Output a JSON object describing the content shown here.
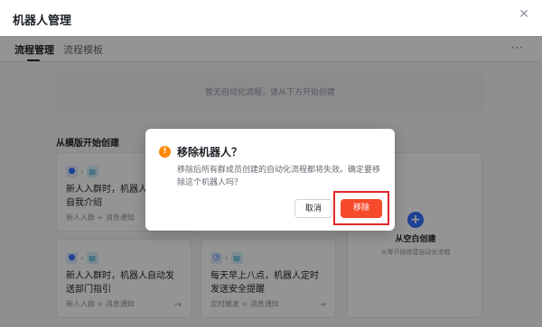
{
  "window": {
    "title": "机器人管理",
    "close_icon": "close-icon"
  },
  "tabs": [
    {
      "label": "流程管理",
      "active": true
    },
    {
      "label": "流程模板",
      "active": false
    }
  ],
  "more_icon": "more-icon",
  "empty_banner": "暂无自动化流程，请从下方开始创建",
  "template_section_title": "从模版开始创建",
  "cards": [
    {
      "title": "新人入群时，机器人自动做自我介绍",
      "meta": "新人入群 + 消息通知",
      "trigger_icon": "user-join-icon",
      "action_icon": "message-icon"
    },
    {
      "title": "新人入群时，机器人自动发送部门指引",
      "meta": "新人入群 + 消息通知",
      "trigger_icon": "user-join-icon",
      "action_icon": "message-icon"
    },
    {
      "title": "每天早上八点，机器人定时发送安全提醒",
      "meta": "定时触发 + 消息通知",
      "trigger_icon": "clock-icon",
      "action_icon": "message-icon"
    }
  ],
  "blank_create": {
    "title": "从空白创建",
    "subtitle": "从零开始搭建自动化流程"
  },
  "dialog": {
    "title": "移除机器人？",
    "body": "移除后所有群成员创建的自动化流程都将失效。确定要移除这个机器人吗？",
    "cancel_label": "取消",
    "confirm_label": "移除",
    "warning_icon": "warning-icon"
  },
  "colors": {
    "accent": "#3370ff",
    "danger": "#f54a2b",
    "warning": "#ff8800",
    "highlight": "#e0262a"
  }
}
